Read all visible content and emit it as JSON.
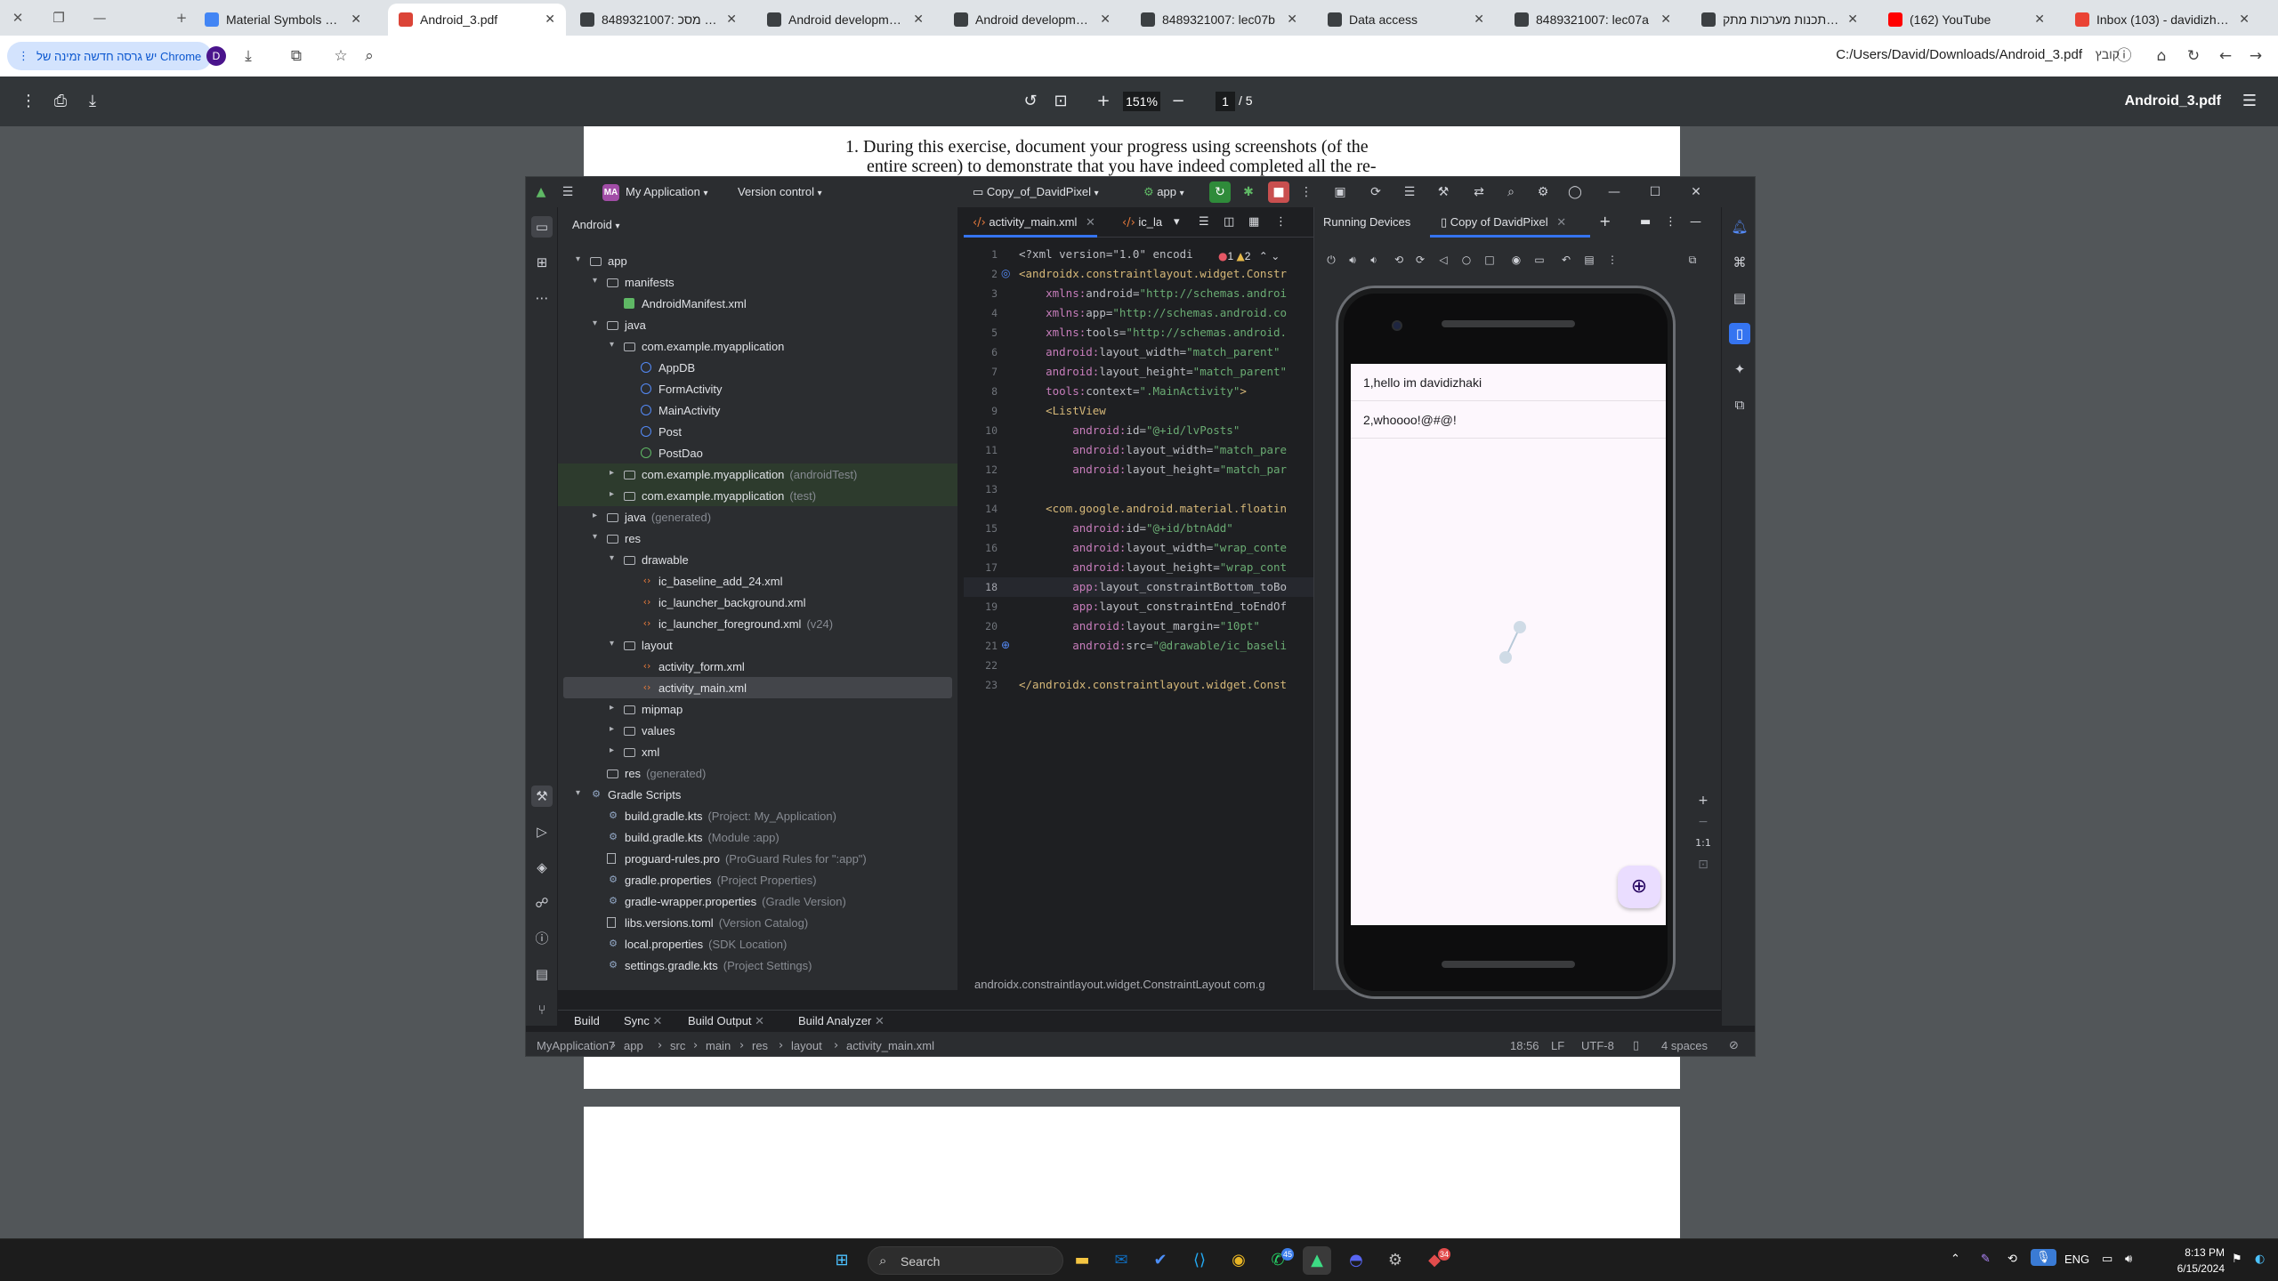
{
  "browser": {
    "tabs": [
      {
        "title": "Material Symbols & Icons",
        "favicon_color": "#4285f4"
      },
      {
        "title": "Android_3.pdf",
        "favicon_color": "#db4437",
        "active": true
      },
      {
        "title": "8489321007: תרגילון מסכ",
        "favicon_color": "#3c4043"
      },
      {
        "title": "Android development",
        "favicon_color": "#3c4043"
      },
      {
        "title": "Android development",
        "favicon_color": "#3c4043"
      },
      {
        "title": "8489321007: lec07b",
        "favicon_color": "#3c4043"
      },
      {
        "title": "Data access",
        "favicon_color": "#3c4043"
      },
      {
        "title": "8489321007: lec07a",
        "favicon_color": "#3c4043"
      },
      {
        "title": "קורס: תכנות מערכות מתק",
        "favicon_color": "#3c4043"
      },
      {
        "title": "(162) YouTube",
        "favicon_color": "#ff0000"
      },
      {
        "title": "Inbox (103) - davidizhaki",
        "favicon_color": "#ea4335"
      }
    ],
    "update_chip": "יש גרסה חדשה זמינה של Chrome",
    "profile_initial": "D",
    "url": "C:/Users/David/Downloads/Android_3.pdf",
    "url_label": "קובץ"
  },
  "pdf": {
    "zoom": "151%",
    "page_current": "1",
    "page_total": "/ 5",
    "title": "Android_3.pdf",
    "text_line1": "1. During this exercise, document your progress using screenshots (of the",
    "text_line2": "entire screen) to demonstrate that you have indeed completed all the re-"
  },
  "studio": {
    "logo": "▲",
    "project_badge": "MA",
    "project_name": "My Application",
    "vcs": "Version control",
    "device_selector": "Copy_of_DavidPixel",
    "run_config": "app",
    "project_view": "Android",
    "tree": [
      {
        "label": "app",
        "depth": 0,
        "arrow": "▾",
        "icon": "folder"
      },
      {
        "label": "manifests",
        "depth": 1,
        "arrow": "▾",
        "icon": "folder"
      },
      {
        "label": "AndroidManifest.xml",
        "depth": 2,
        "arrow": "",
        "icon": "mani"
      },
      {
        "label": "java",
        "depth": 1,
        "arrow": "▾",
        "icon": "folder"
      },
      {
        "label": "com.example.myapplication",
        "depth": 2,
        "arrow": "▾",
        "icon": "pkg"
      },
      {
        "label": "AppDB",
        "depth": 3,
        "arrow": "",
        "icon": "cls"
      },
      {
        "label": "FormActivity",
        "depth": 3,
        "arrow": "",
        "icon": "cls"
      },
      {
        "label": "MainActivity",
        "depth": 3,
        "arrow": "",
        "icon": "cls"
      },
      {
        "label": "Post",
        "depth": 3,
        "arrow": "",
        "icon": "cls"
      },
      {
        "label": "PostDao",
        "depth": 3,
        "arrow": "",
        "icon": "iface"
      },
      {
        "label": "com.example.myapplication",
        "suffix": "(androidTest)",
        "depth": 2,
        "arrow": "▸",
        "icon": "pkg",
        "hl": true
      },
      {
        "label": "com.example.myapplication",
        "suffix": "(test)",
        "depth": 2,
        "arrow": "▸",
        "icon": "pkg",
        "hl": true
      },
      {
        "label": "java",
        "suffix": "(generated)",
        "depth": 1,
        "arrow": "▸",
        "icon": "folder"
      },
      {
        "label": "res",
        "depth": 1,
        "arrow": "▾",
        "icon": "folder"
      },
      {
        "label": "drawable",
        "depth": 2,
        "arrow": "▾",
        "icon": "folder"
      },
      {
        "label": "ic_baseline_add_24.xml",
        "depth": 3,
        "arrow": "",
        "icon": "xml"
      },
      {
        "label": "ic_launcher_background.xml",
        "depth": 3,
        "arrow": "",
        "icon": "xml"
      },
      {
        "label": "ic_launcher_foreground.xml",
        "suffix": "(v24)",
        "depth": 3,
        "arrow": "",
        "icon": "xml"
      },
      {
        "label": "layout",
        "depth": 2,
        "arrow": "▾",
        "icon": "folder"
      },
      {
        "label": "activity_form.xml",
        "depth": 3,
        "arrow": "",
        "icon": "xml"
      },
      {
        "label": "activity_main.xml",
        "depth": 3,
        "arrow": "",
        "icon": "xml",
        "sel": true
      },
      {
        "label": "mipmap",
        "depth": 2,
        "arrow": "▸",
        "icon": "folder"
      },
      {
        "label": "values",
        "depth": 2,
        "arrow": "▸",
        "icon": "folder"
      },
      {
        "label": "xml",
        "depth": 2,
        "arrow": "▸",
        "icon": "folder"
      },
      {
        "label": "res",
        "suffix": "(generated)",
        "depth": 1,
        "arrow": "",
        "icon": "folder"
      },
      {
        "label": "Gradle Scripts",
        "depth": 0,
        "arrow": "▾",
        "icon": "grad"
      },
      {
        "label": "build.gradle.kts",
        "suffix": "(Project: My_Application)",
        "depth": 1,
        "arrow": "",
        "icon": "grad"
      },
      {
        "label": "build.gradle.kts",
        "suffix": "(Module :app)",
        "depth": 1,
        "arrow": "",
        "icon": "grad"
      },
      {
        "label": "proguard-rules.pro",
        "suffix": "(ProGuard Rules for \":app\")",
        "depth": 1,
        "arrow": "",
        "icon": "file"
      },
      {
        "label": "gradle.properties",
        "suffix": "(Project Properties)",
        "depth": 1,
        "arrow": "",
        "icon": "grad"
      },
      {
        "label": "gradle-wrapper.properties",
        "suffix": "(Gradle Version)",
        "depth": 1,
        "arrow": "",
        "icon": "grad"
      },
      {
        "label": "libs.versions.toml",
        "suffix": "(Version Catalog)",
        "depth": 1,
        "arrow": "",
        "icon": "file"
      },
      {
        "label": "local.properties",
        "suffix": "(SDK Location)",
        "depth": 1,
        "arrow": "",
        "icon": "grad"
      },
      {
        "label": "settings.gradle.kts",
        "suffix": "(Project Settings)",
        "depth": 1,
        "arrow": "",
        "icon": "grad"
      }
    ],
    "editor_tabs": [
      "activity_main.xml",
      "ic_la"
    ],
    "inspections": {
      "errors": "1",
      "warnings": "2"
    },
    "code_lines": [
      [
        [
          "c-decl",
          "<?xml version=\"1.0\" encodi"
        ]
      ],
      [
        [
          "c-tag",
          "<androidx.constraintlayout.widget.Constr"
        ]
      ],
      [
        [
          "c-ns",
          "    xmlns:"
        ],
        [
          "c-attr",
          "android="
        ],
        [
          "c-val",
          "\"http://schemas.androi"
        ]
      ],
      [
        [
          "c-ns",
          "    xmlns:"
        ],
        [
          "c-attr",
          "app="
        ],
        [
          "c-val",
          "\"http://schemas.android.co"
        ]
      ],
      [
        [
          "c-ns",
          "    xmlns:"
        ],
        [
          "c-attr",
          "tools="
        ],
        [
          "c-val",
          "\"http://schemas.android."
        ]
      ],
      [
        [
          "c-ns",
          "    android:"
        ],
        [
          "c-attr",
          "layout_width="
        ],
        [
          "c-val",
          "\"match_parent\""
        ]
      ],
      [
        [
          "c-ns",
          "    android:"
        ],
        [
          "c-attr",
          "layout_height="
        ],
        [
          "c-val",
          "\"match_parent\""
        ]
      ],
      [
        [
          "c-ns",
          "    tools:"
        ],
        [
          "c-attr",
          "context="
        ],
        [
          "c-val",
          "\".MainActivity\""
        ],
        [
          "c-tag",
          ">"
        ]
      ],
      [
        [
          "c-tag",
          "    <ListView"
        ]
      ],
      [
        [
          "c-ns",
          "        android:"
        ],
        [
          "c-attr",
          "id="
        ],
        [
          "c-val",
          "\"@+id/lvPosts\""
        ]
      ],
      [
        [
          "c-ns",
          "        android:"
        ],
        [
          "c-attr",
          "layout_width="
        ],
        [
          "c-val",
          "\"match_pare"
        ]
      ],
      [
        [
          "c-ns",
          "        android:"
        ],
        [
          "c-attr",
          "layout_height="
        ],
        [
          "c-val",
          "\"match_par"
        ]
      ],
      [
        [
          "c-attr",
          ""
        ]
      ],
      [
        [
          "c-tag",
          "    <com.google.android.material.floatin"
        ]
      ],
      [
        [
          "c-ns",
          "        android:"
        ],
        [
          "c-attr",
          "id="
        ],
        [
          "c-val",
          "\"@+id/btnAdd\""
        ]
      ],
      [
        [
          "c-ns",
          "        android:"
        ],
        [
          "c-attr",
          "layout_width="
        ],
        [
          "c-val",
          "\"wrap_conte"
        ]
      ],
      [
        [
          "c-ns",
          "        android:"
        ],
        [
          "c-attr",
          "layout_height="
        ],
        [
          "c-val",
          "\"wrap_cont"
        ]
      ],
      [
        [
          "c-ns",
          "        app:"
        ],
        [
          "c-attr",
          "layout_constraintBottom_toBo"
        ]
      ],
      [
        [
          "c-ns",
          "        app:"
        ],
        [
          "c-attr",
          "layout_constraintEnd_toEndOf"
        ]
      ],
      [
        [
          "c-ns",
          "        android:"
        ],
        [
          "c-attr",
          "layout_margin="
        ],
        [
          "c-val",
          "\"10pt\""
        ]
      ],
      [
        [
          "c-ns",
          "        android:"
        ],
        [
          "c-attr",
          "src="
        ],
        [
          "c-val",
          "\"@drawable/ic_baseli"
        ]
      ],
      [
        [
          "c-attr",
          ""
        ]
      ],
      [
        [
          "c-tag",
          "</androidx.constraintlayout.widget.Const"
        ]
      ]
    ],
    "current_line": 18,
    "editor_breadcrumb": "androidx.constraintlayout.widget.ConstraintLayout    com.g",
    "device_tabs": {
      "running": "Running Devices",
      "device": "Copy of DavidPixel"
    },
    "app_items": [
      "1,hello im davidizhaki",
      "2,whoooo!@#@!"
    ],
    "zoom_ratio": "1:1",
    "build_tabs": [
      "Build",
      "Sync",
      "Build Output",
      "Build Analyzer"
    ],
    "status_path": [
      "MyApplication7",
      "app",
      "src",
      "main",
      "res",
      "layout",
      "activity_main.xml"
    ],
    "status_right": {
      "pos": "18:56",
      "eol": "LF",
      "enc": "UTF-8",
      "indent": "4 spaces"
    }
  },
  "taskbar": {
    "search": "Search",
    "lang": "ENG",
    "time": "8:13 PM",
    "date": "6/15/2024",
    "badge_whatsapp": "45",
    "badge_outlook": "",
    "badge_discord": "34"
  }
}
